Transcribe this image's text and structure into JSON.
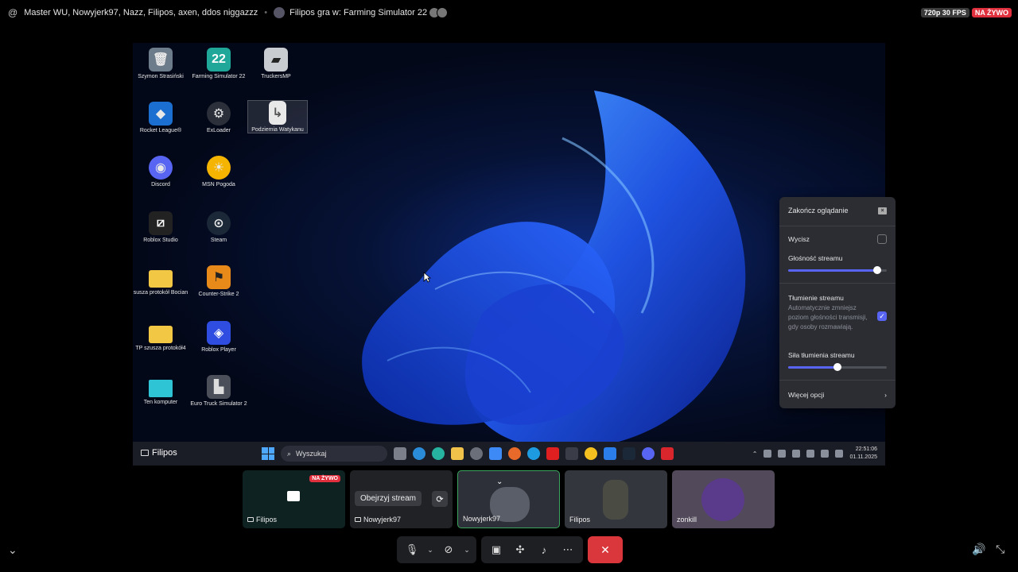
{
  "topbar": {
    "channel": "Master WU, Nowyjerk97, Nazz, Filipos, axen, ddos niggazzz",
    "activity": "Filipos gra w: Farming Simulator 22",
    "quality": "720p 30 FPS",
    "live": "NA ŻYWO"
  },
  "desktop": {
    "icons": [
      {
        "label": "Szymon Strasiński",
        "icon": "recycle-bin-icon"
      },
      {
        "label": "Farming Simulator 22",
        "icon": "fs22-icon"
      },
      {
        "label": "TruckersMP",
        "icon": "truckersmp-icon"
      },
      {
        "label": "Rocket League®",
        "icon": "rocket-league-icon"
      },
      {
        "label": "ExLoader",
        "icon": "exloader-icon"
      },
      {
        "label": "Podziemia Watykanu",
        "icon": "file-icon"
      },
      {
        "label": "Discord",
        "icon": "discord-icon"
      },
      {
        "label": "MSN Pogoda",
        "icon": "weather-icon"
      },
      {
        "label": "Roblox Studio",
        "icon": "roblox-studio-icon"
      },
      {
        "label": "Steam",
        "icon": "steam-icon"
      },
      {
        "label": "susza protokół Bocian",
        "icon": "folder-icon"
      },
      {
        "label": "Counter-Strike 2",
        "icon": "cs2-icon"
      },
      {
        "label": "TP szusza protokół4",
        "icon": "folder-icon"
      },
      {
        "label": "Roblox Player",
        "icon": "roblox-icon"
      },
      {
        "label": "Ten komputer",
        "icon": "computer-icon"
      },
      {
        "label": "Euro Truck Simulator 2",
        "icon": "ets2-icon"
      }
    ],
    "taskbar": {
      "stream_label": "Filipos",
      "search_placeholder": "Wyszukaj",
      "time": "22:51:06",
      "date": "01.11.2025"
    }
  },
  "popup": {
    "end_watching": "Zakończ oglądanie",
    "mute": "Wycisz",
    "stream_volume": "Głośność streamu",
    "stream_volume_value": 0.9,
    "ducking": "Tłumienie streamu",
    "ducking_desc": "Automatycznie zmniejsz poziom głośności transmisji, gdy osoby rozmawiają.",
    "ducking_strength": "Siła tłumienia streamu",
    "ducking_strength_value": 0.5,
    "more_options": "Więcej opcji"
  },
  "thumbs": {
    "t1_name": "Filipos",
    "t1_live": "NA ŻYWO",
    "t2_name": "Nowyjerk97",
    "t2_watch": "Obejrzyj stream",
    "t3_name": "Nowyjerk97",
    "t4_name": "Filipos",
    "t5_name": "zonkill"
  },
  "colors": {
    "accent": "#5865f2",
    "live": "#e0303e",
    "end_call": "#da373c",
    "active_border": "#3ba55d"
  }
}
